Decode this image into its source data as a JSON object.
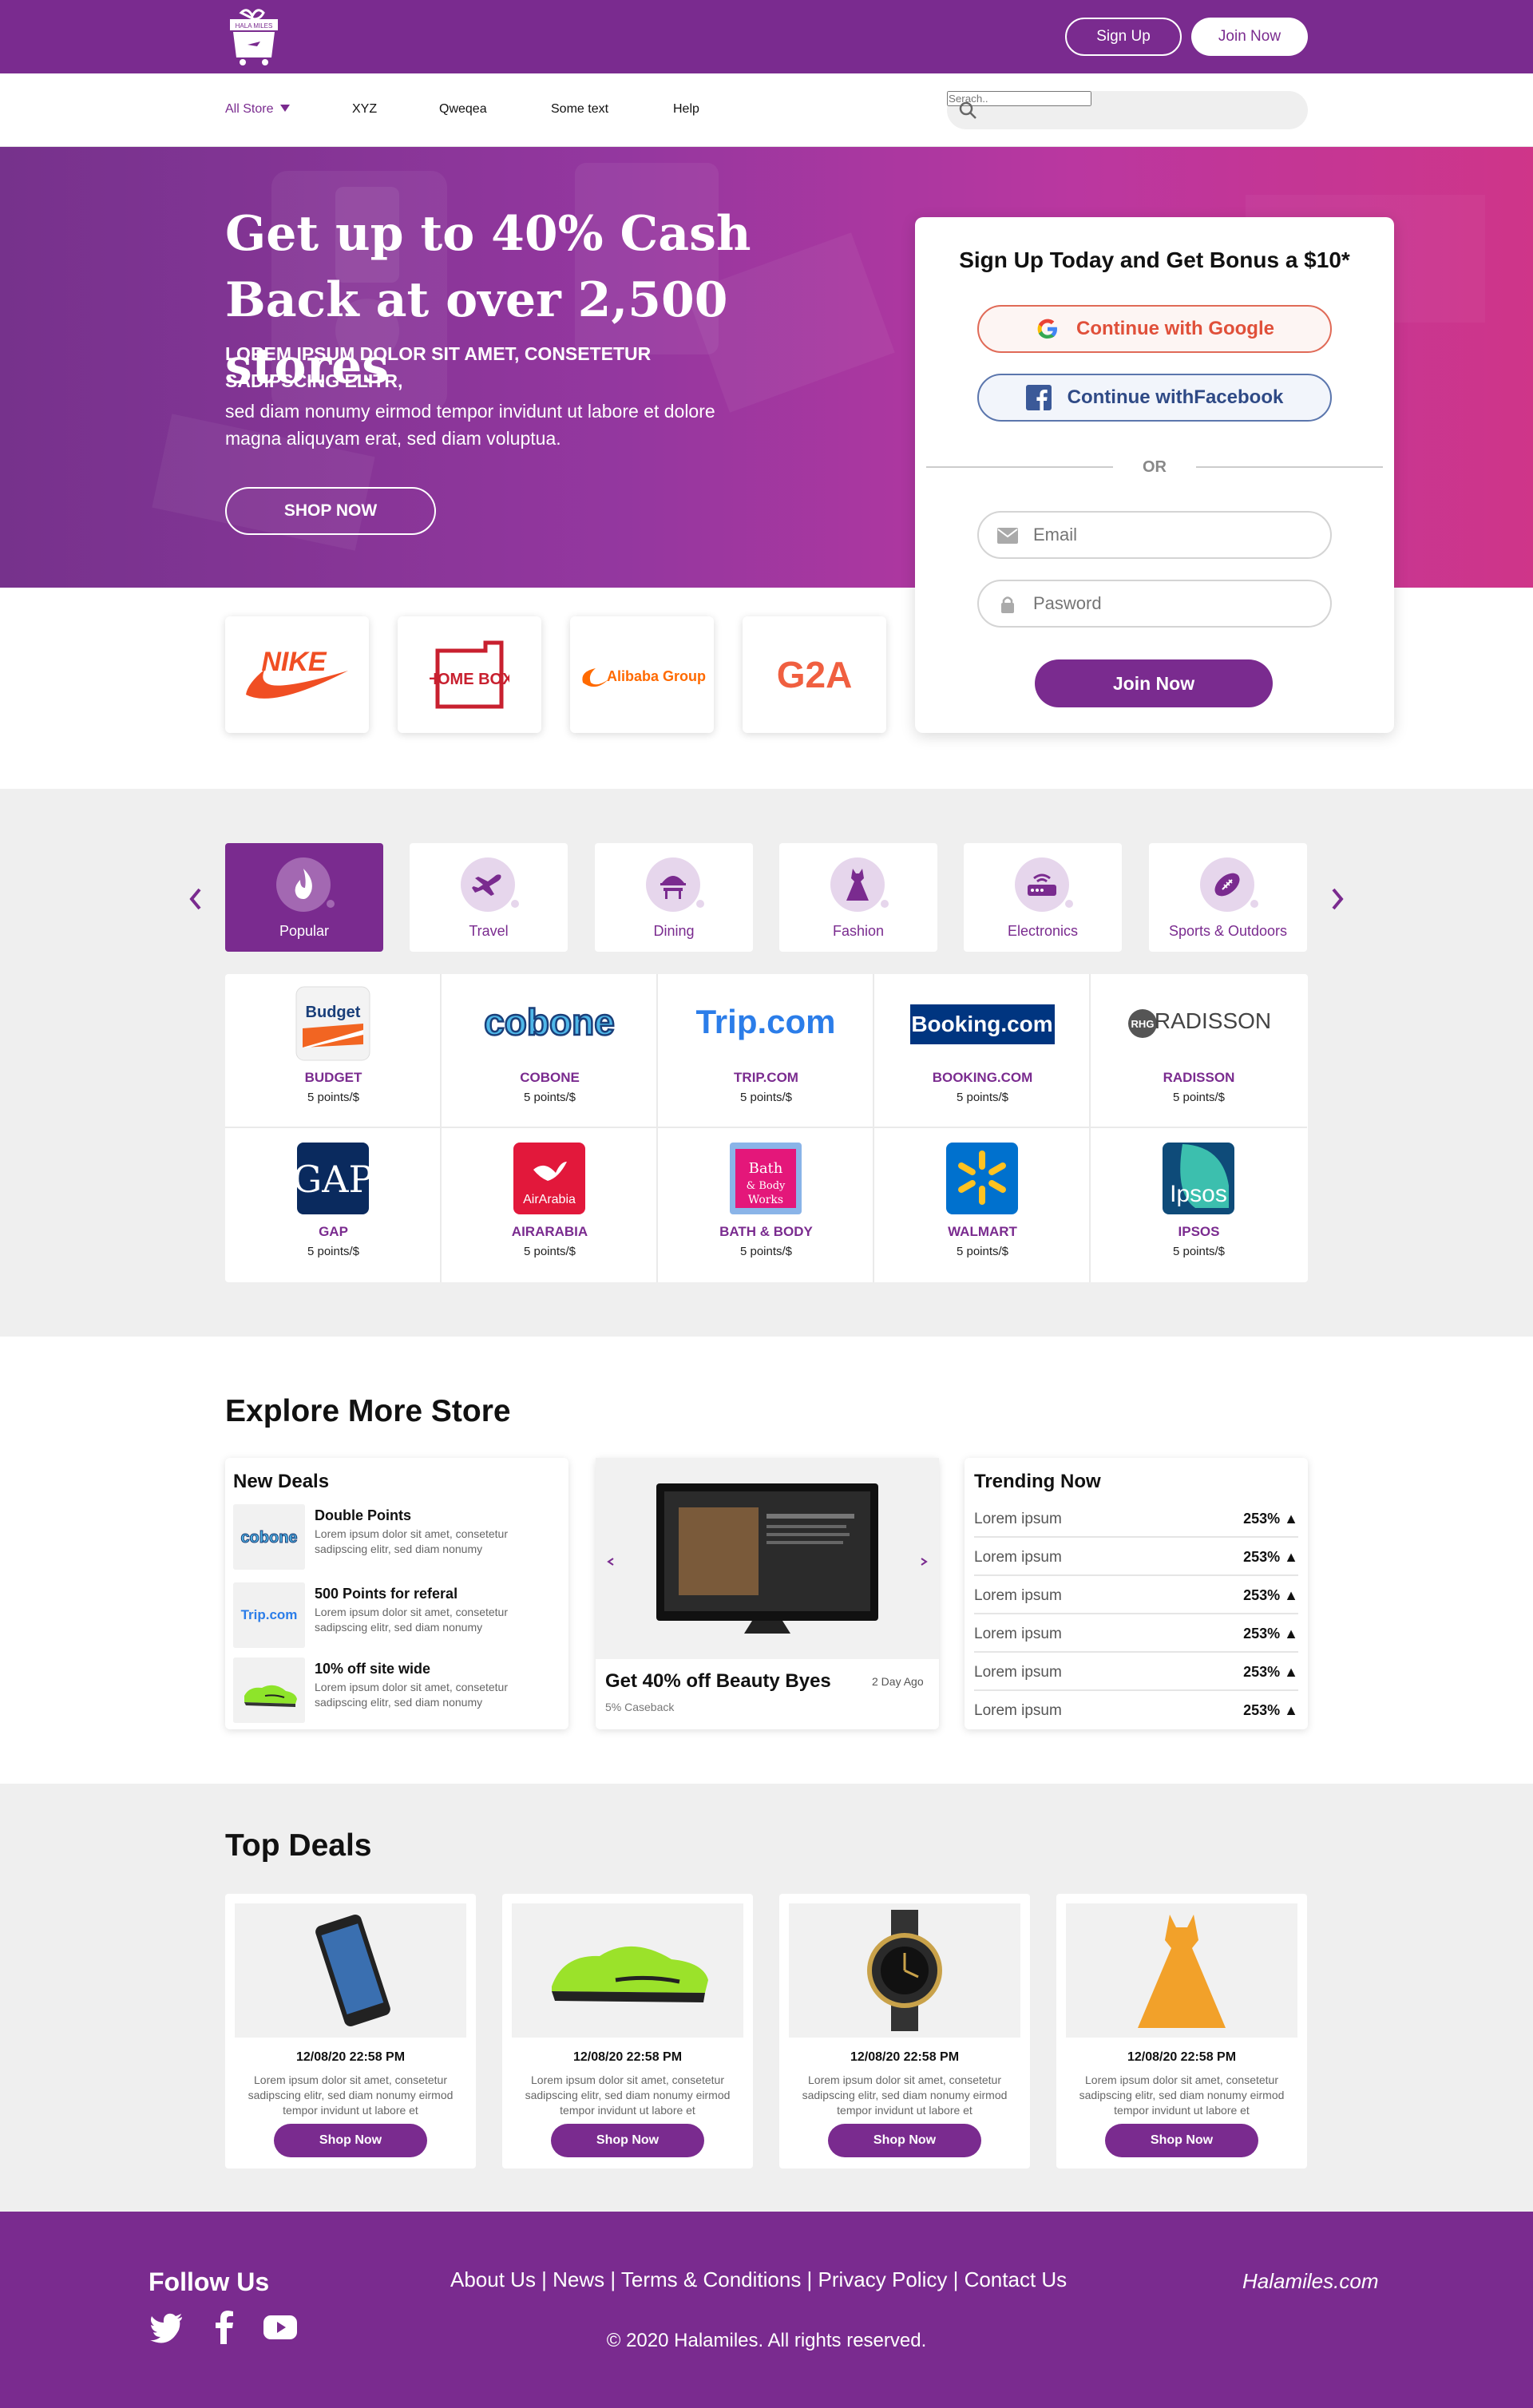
{
  "header": {
    "logo_text": "HALA MILES",
    "signup_label": "Sign Up",
    "joinnow_label": "Join Now",
    "brand_color": "#7a2b8f"
  },
  "nav": {
    "all_store": "All Store",
    "items": [
      "XYZ",
      "Qweqea",
      "Some text",
      "Help"
    ],
    "search_placeholder": "Serach.."
  },
  "hero": {
    "title": "Get up to 40% Cash Back at over 2,500 stores",
    "subtitle": "LOREM IPSUM DOLOR SIT AMET, CONSETETUR SADIPSCING ELITR,",
    "body": "sed diam nonumy eirmod tempor invidunt ut labore et dolore magna aliquyam erat, sed diam voluptua.",
    "cta": "SHOP NOW"
  },
  "brands": [
    "NIKE",
    "HOME BOX",
    "Alibaba Group",
    "G2A"
  ],
  "signup": {
    "title": "Sign Up Today and Get Bonus a $10*",
    "google": "Continue with Google",
    "facebook": "Continue withFacebook",
    "or": "OR",
    "email_placeholder": "Email",
    "password_placeholder": "Pasword",
    "join": "Join Now"
  },
  "categories": [
    {
      "label": "Popular",
      "icon": "fire-icon",
      "active": true
    },
    {
      "label": "Travel",
      "icon": "plane-icon"
    },
    {
      "label": "Dining",
      "icon": "dining-icon"
    },
    {
      "label": "Fashion",
      "icon": "dress-icon"
    },
    {
      "label": "Electronics",
      "icon": "router-icon"
    },
    {
      "label": "Sports & Outdoors",
      "icon": "football-icon"
    }
  ],
  "stores": [
    {
      "name": "BUDGET",
      "points": "5 points/$",
      "logo": "Budget"
    },
    {
      "name": "COBONE",
      "points": "5 points/$",
      "logo": "cobone"
    },
    {
      "name": "TRIP.COM",
      "points": "5 points/$",
      "logo": "Trip.com"
    },
    {
      "name": "BOOKING.COM",
      "points": "5 points/$",
      "logo": "Booking.com"
    },
    {
      "name": "RADISSON",
      "points": "5 points/$",
      "logo": "RADISSON"
    },
    {
      "name": "GAP",
      "points": "5 points/$",
      "logo": "GAP"
    },
    {
      "name": "AIRARABIA",
      "points": "5 points/$",
      "logo": "AirArabia"
    },
    {
      "name": "BATH & BODY",
      "points": "5 points/$",
      "logo": "Bath & Body Works"
    },
    {
      "name": "WALMART",
      "points": "5 points/$",
      "logo": "walmart"
    },
    {
      "name": "IPSOS",
      "points": "5 points/$",
      "logo": "Ipsos"
    }
  ],
  "explore": {
    "title": "Explore More Store",
    "new_deals_title": "New Deals",
    "deals": [
      {
        "name": "Double Points",
        "desc": "Lorem ipsum dolor sit amet, consetetur sadipscing elitr, sed diam nonumy",
        "logo": "cobone"
      },
      {
        "name": "500 Points for referal",
        "desc": "Lorem ipsum dolor sit amet, consetetur sadipscing elitr, sed diam nonumy",
        "logo": "Trip.com"
      },
      {
        "name": "10% off site wide",
        "desc": "Lorem ipsum dolor sit amet, consetetur sadipscing elitr, sed diam nonumy",
        "logo": "shoe"
      }
    ],
    "promo": {
      "title": "Get 40% off Beauty Byes",
      "subtitle": "5% Caseback",
      "age": "2  Day Ago"
    },
    "trending_title": "Trending Now",
    "trending": [
      {
        "name": "Lorem ipsum",
        "value": "253%"
      },
      {
        "name": "Lorem ipsum",
        "value": "253%"
      },
      {
        "name": "Lorem ipsum",
        "value": "253%"
      },
      {
        "name": "Lorem ipsum",
        "value": "253%"
      },
      {
        "name": "Lorem ipsum",
        "value": "253%"
      },
      {
        "name": "Lorem ipsum",
        "value": "253%"
      }
    ]
  },
  "top_deals": {
    "title": "Top Deals",
    "items": [
      {
        "date": "12/08/20 22:58 PM",
        "desc": "Lorem ipsum dolor sit amet, consetetur sadipscing elitr, sed diam nonumy eirmod tempor invidunt ut labore et",
        "cta": "Shop Now",
        "image": "phone"
      },
      {
        "date": "12/08/20 22:58 PM",
        "desc": "Lorem ipsum dolor sit amet, consetetur sadipscing elitr, sed diam nonumy eirmod tempor invidunt ut labore et",
        "cta": "Shop Now",
        "image": "sneaker"
      },
      {
        "date": "12/08/20 22:58 PM",
        "desc": "Lorem ipsum dolor sit amet, consetetur sadipscing elitr, sed diam nonumy eirmod tempor invidunt ut labore et",
        "cta": "Shop Now",
        "image": "watch"
      },
      {
        "date": "12/08/20 22:58 PM",
        "desc": "Lorem ipsum dolor sit amet, consetetur sadipscing elitr, sed diam nonumy eirmod tempor invidunt ut labore et",
        "cta": "Shop Now",
        "image": "dress"
      }
    ]
  },
  "footer": {
    "follow": "Follow Us",
    "links": [
      "About Us",
      "News",
      "Terms & Conditions",
      "Privacy Policy",
      "Contact Us"
    ],
    "separator": " | ",
    "brand": "Halamiles.com",
    "copyright": "© 2020 Halamiles. All rights reserved."
  }
}
